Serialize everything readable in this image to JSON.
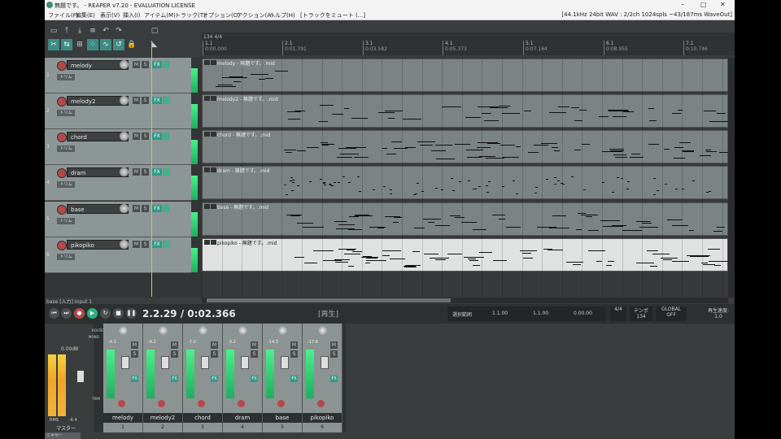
{
  "window": {
    "title": "無題です。 - REAPER v7.20 - EVALUATION LICENSE",
    "status": "[44.1kHz 24bit WAV : 2/2ch 1024spls ~43/187ms WaveOut]"
  },
  "menu": [
    "ファイル(F)",
    "編集(E)",
    "表示(V)",
    "挿入(I)",
    "アイテム(M)",
    "トラック(T)",
    "オプション(O)",
    "アクション(A)",
    "ヘルプ(H)",
    "[トラックをミュート (...]"
  ],
  "ruler": {
    "sig": "134 4/4",
    "ticks": [
      {
        "bar": "1.1",
        "time": "0:00.000"
      },
      {
        "bar": "2.1",
        "time": "0:01.791"
      },
      {
        "bar": "3.1",
        "time": "0:03.582"
      },
      {
        "bar": "4.1",
        "time": "0:05.373"
      },
      {
        "bar": "5.1",
        "time": "0:07.164"
      },
      {
        "bar": "6.1",
        "time": "0:08.955"
      },
      {
        "bar": "7.1",
        "time": "0:10.746"
      }
    ]
  },
  "tracks": [
    {
      "num": "1",
      "name": "melody",
      "item": "melody - 無題です。.mid"
    },
    {
      "num": "2",
      "name": "melody2",
      "item": "melody2 - 無題です。.mid"
    },
    {
      "num": "3",
      "name": "chord",
      "item": "chord - 無題です。.mid"
    },
    {
      "num": "4",
      "name": "dram",
      "item": "dram - 無題です。.mid"
    },
    {
      "num": "5",
      "name": "base",
      "item": "base - 無題です。.mid"
    },
    {
      "num": "6",
      "name": "pikopiko",
      "item": "pikopiko - 無題です。.mid"
    }
  ],
  "track_labels": {
    "mute": "M",
    "solo": "S",
    "fx": "FX",
    "trim": "トリム"
  },
  "input_label": "base [入力] Input 1",
  "transport": {
    "position": "2.2.29 / 0:02.366",
    "state": "[再生]",
    "sel_label": "選択範囲",
    "sel_start": "1.1.00",
    "sel_end": "1.1.00",
    "sel_len": "0.00.00",
    "sig": "4/4",
    "tempo_label": "テンポ",
    "tempo": "134",
    "global": "GLOBAL",
    "global_off": "OFF",
    "rate_label": "再生速度:",
    "rate": "1.0"
  },
  "mixer": {
    "master_label": "マスター",
    "master_db": "0.00dB",
    "rms": "RMS",
    "rms_val": "-6.4",
    "mono": "MONO",
    "route": "ROUTE",
    "trim": "TRIM",
    "strips": [
      {
        "name": "melody",
        "num": "1",
        "val": "-4.3"
      },
      {
        "name": "melody2",
        "num": "2",
        "val": "-4.2"
      },
      {
        "name": "chord",
        "num": "3",
        "val": "-7.0"
      },
      {
        "name": "dram",
        "num": "4",
        "val": "-3.2"
      },
      {
        "name": "base",
        "num": "5",
        "val": "-14.3"
      },
      {
        "name": "pikopiko",
        "num": "6",
        "val": "-17.6"
      }
    ]
  },
  "tab": "ミキサー"
}
